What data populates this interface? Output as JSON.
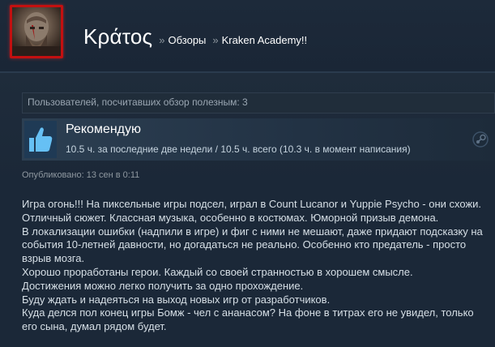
{
  "header": {
    "profile_name": "Κράτος",
    "separator": "»",
    "crumb_reviews": "Обзоры",
    "crumb_game": "Kraken Academy!!"
  },
  "helpful": {
    "text": "Пользователей, посчитавших обзор полезным: 3"
  },
  "recommendation": {
    "title": "Рекомендую",
    "hours": "10.5 ч. за последние две недели / 10.5 ч. всего (10.3 ч. в момент написания)",
    "thumb_icon": "thumbs-up-icon",
    "platform_icon": "steam-icon"
  },
  "posted": "Опубликовано: 13 сен в 0:11",
  "review_lines": [
    "Игра огонь!!! На пиксельные игры подсел, играл в Count Lucanor и Yuppie Psycho - они схожи.",
    "Отличный сюжет. Классная музыка, особенно в костюмах. Юморной призыв демона.",
    "В локализации ошибки (надпили в игре) и фиг с ними не мешают, даже придают подсказку на",
    "события 10-летней давности, но догадаться не реально. Особенно кто предатель - просто",
    "взрыв мозга.",
    "Хорошо проработаны герои. Каждый со своей странностью в хорошем смысле.",
    "Достижения можно легко получить за одно прохождение.",
    "Буду ждать и надеяться на выход новых игр от разработчиков.",
    "Куда делся пол конец игры Бомж - чел с ананасом? На фоне в титрах его не увидел, только",
    "его сына, думал рядом будет."
  ],
  "colors": {
    "background": "#1b2838",
    "avatar_frame": "#c31010",
    "recommend_bg": "#2c3f52",
    "thumb_blue": "#66c0f4"
  }
}
